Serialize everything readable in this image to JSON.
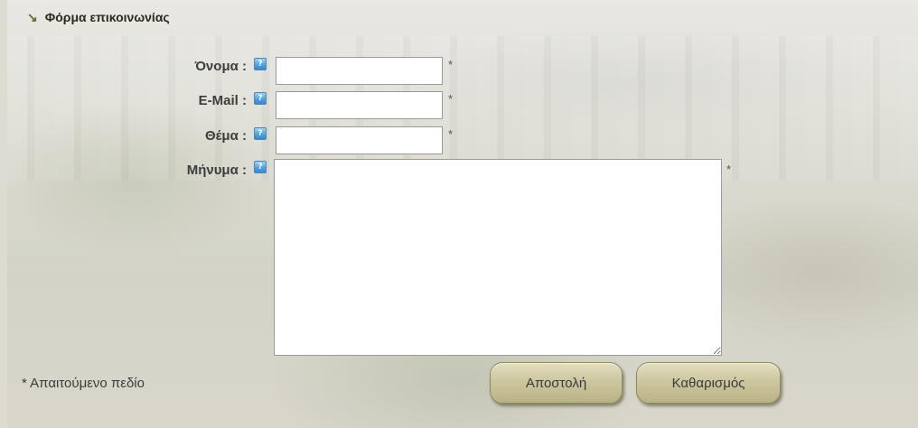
{
  "form": {
    "title": "Φόρμα επικοινωνίας",
    "title_icon": "arrow-down-right-icon",
    "help_icon": "help-icon",
    "help_glyph": "?",
    "fields": {
      "name": {
        "label": "Όνομα :",
        "value": "",
        "required_mark": "*"
      },
      "email": {
        "label": "E-Mail :",
        "value": "",
        "required_mark": "*"
      },
      "subject": {
        "label": "Θέμα :",
        "value": "",
        "required_mark": "*"
      },
      "message": {
        "label": "Μήνυμα :",
        "value": "",
        "required_mark": "*"
      }
    },
    "required_note": "* Απαιτούμενο πεδίο",
    "buttons": {
      "send": "Αποστολή",
      "reset": "Καθαρισμός"
    }
  },
  "colors": {
    "button_bg": "#cdc79f",
    "help_icon": "#4f9fd8",
    "title_arrow": "#6b6a2a"
  }
}
